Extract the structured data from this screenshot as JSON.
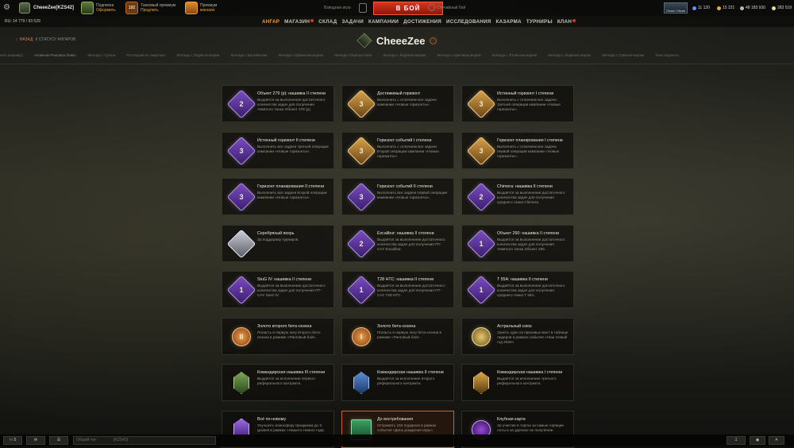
{
  "topbar": {
    "player": "CheeeZee[KZS42]",
    "premium1": {
      "title": "Подписка",
      "action": "Оформить"
    },
    "premium2": {
      "title": "Танковый премиум",
      "action": "Продлить",
      "count": "192"
    },
    "premium3": {
      "title": "Премиум",
      "action": "магазин"
    },
    "battle_label": "В БОЙ",
    "mode_left": "Взводная игра",
    "mode_right": "Случайный бой",
    "tank_name": "23мин 23мин",
    "res1": "11 120",
    "res2": "15 221",
    "res3": "48 183 930",
    "res4": "283 519"
  },
  "funds_line": "RU: 14 779  /  93 529",
  "nav": [
    "АНГАР",
    "МАГАЗИН",
    "СКЛАД",
    "ЗАДАЧИ",
    "КАМПАНИИ",
    "ДОСТИЖЕНИЯ",
    "ИССЛЕДОВАНИЯ",
    "КАЗАРМА",
    "ТУРНИРЫ",
    "КЛАН"
  ],
  "nav_active": "АНГАР",
  "back": {
    "label": "НАЗАД",
    "sub": "К СТАТУСУ АНГАРОВ"
  },
  "header": {
    "name": "CheeeZee"
  },
  "tabs": [
    "кать нашивку)",
    "«Новичок Ранговых боёв»",
    "Легенда с Гусёна",
    "Последний из смертных",
    "Легенда с Ледяном морем",
    "Легенда с Балтийском",
    "Легенда с Каменном морем",
    "Легенда Сборных боёв",
    "Легенда с Ледяном морем",
    "Легенда с Кратовом морем",
    "Легенда с Отличном морем",
    "Легенда с Ледяном морем",
    "Легенда с Гривном морем",
    "Тени ледяного"
  ],
  "cards": [
    {
      "title": "Объект 279 (р): нашивка II степени",
      "desc": "Выдаётся за выполнение достаточного количества задач для получения тяжёлого танка Объект 279 (р).",
      "icon": "purple-rank-2",
      "num": "2"
    },
    {
      "title": "Достижимый горизонт",
      "desc": "Выполнить с отличием все задачи кампании «Новые горизонты».",
      "icon": "gold-rank-3",
      "num": "3"
    },
    {
      "title": "Истинный горизонт I степени",
      "desc": "Выполнить с отличием все задачи третьей операции кампании «Новые горизонты».",
      "icon": "gold-rank-3",
      "num": "3"
    },
    {
      "title": "Истинный горизонт II степени",
      "desc": "Выполнить все задачи третьей операции кампании «Новые горизонты».",
      "icon": "purple-rank-3",
      "num": "3"
    },
    {
      "title": "Горизонт событий I степени",
      "desc": "Выполнить с отличием все задачи второй операции кампании «Новые горизонты».",
      "icon": "gold-rank-3",
      "num": "3"
    },
    {
      "title": "Горизонт планирования I степени",
      "desc": "Выполнить с отличием все задачи первой операции кампании «Новые горизонты».",
      "icon": "gold-rank-3",
      "num": "3"
    },
    {
      "title": "Горизонт планирования II степени",
      "desc": "Выполнить все задачи второй операции кампании «Новые горизонты».",
      "icon": "purple-rank-3",
      "num": "3"
    },
    {
      "title": "Горизонт событий II степени",
      "desc": "Выполнить все задачи первой операции кампании «Новые горизонты».",
      "icon": "purple-rank-3",
      "num": "3"
    },
    {
      "title": "Chimera: нашивка II степени",
      "desc": "Выдаётся за выполнение достаточного количества задач для получения среднего танка Chimera.",
      "icon": "purple-rank-2",
      "num": "2"
    },
    {
      "title": "Серебряный якорь",
      "desc": "За поддержку турниров.",
      "icon": "silver-anchor",
      "num": ""
    },
    {
      "title": "Excalibur: нашивка II степени",
      "desc": "Выдаётся за выполнение достаточного количества задач для получения ПТ-САУ Excalibur.",
      "icon": "purple-rank-2",
      "num": "2"
    },
    {
      "title": "Объект 260: нашивка II степени",
      "desc": "Выдаётся за выполнение достаточного количества задач для получения тяжёлого танка Объект 260.",
      "icon": "purple-rank-1",
      "num": "1"
    },
    {
      "title": "StuG IV: нашивка II степени",
      "desc": "Выдаётся за выполнение достаточного количества задач для получения ПТ-САУ StuG IV.",
      "icon": "purple-rank-1",
      "num": "1"
    },
    {
      "title": "T28 HTC: нашивка II степени",
      "desc": "Выдаётся за выполнение достаточного количества задач для получения ПТ-САУ T28 HTC.",
      "icon": "purple-rank-1",
      "num": "1"
    },
    {
      "title": "T 55A: нашивка II степени",
      "desc": "Выдаётся за выполнение достаточного количества задач для получения среднего танка T 55A.",
      "icon": "purple-rank-1",
      "num": "1"
    },
    {
      "title": "Золото второго бета-сезона",
      "desc": "Попасть в первую лигу второго бета-сезона в режиме «Ранговый бой».",
      "icon": "gold-league",
      "num": "II"
    },
    {
      "title": "Золото бета-сезона",
      "desc": "Попасть в первую лигу бета-сезона в режиме «Ранговый бой».",
      "icon": "gold-league",
      "num": "I"
    },
    {
      "title": "Астральный союз",
      "desc": "Занять одно из призовых мест в таблице лидеров в рамках события «Наш Новый год 2026».",
      "icon": "astral-seal",
      "num": ""
    },
    {
      "title": "Командирская нашивка III степени",
      "desc": "Выдаётся за исполнение первого реферального контракта.",
      "icon": "commander-green",
      "num": ""
    },
    {
      "title": "Командирская нашивка II степени",
      "desc": "Выдаётся за исполнение второго реферального контракта.",
      "icon": "commander-blue",
      "num": ""
    },
    {
      "title": "Командирская нашивка I степени",
      "desc": "Выдаётся за исполнение третьего реферального контракта.",
      "icon": "commander-gold",
      "num": ""
    },
    {
      "title": "Всё по-новому",
      "desc": "Улучшить атмосферу праздника до X уровня в рамках «Нашего Нового года.",
      "icon": "purple-crystal",
      "num": ""
    },
    {
      "title": "До востребования",
      "desc": "Отправить 150 подарков в рамках события «День рождения игры».",
      "icon": "gift-box",
      "num": ""
    },
    {
      "title": "Клубная карта",
      "desc": "За участие в торгах за самые горящие лоты и за удачное их получение.",
      "icon": "club-card",
      "num": ""
    }
  ],
  "bottom": {
    "players": "5",
    "chat_placeholder": "Общий чат",
    "chat_channel": "[KZS42]",
    "count": "1"
  }
}
